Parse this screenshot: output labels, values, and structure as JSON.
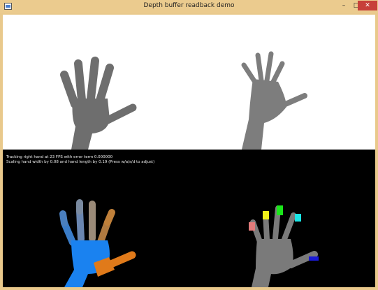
{
  "window": {
    "title": "Depth buffer readback demo",
    "controls": {
      "minimize": "–",
      "maximize": "□",
      "close": "✕"
    }
  },
  "status": {
    "line1": "Tracking right hand at 23 FPS with error term 0.000000",
    "line2": "Scaling hand width by 0.08 and hand length by 0.19 (Press w/a/s/d to adjust)"
  },
  "colors": {
    "titlebar": "#ebcb8e",
    "close": "#c7403a",
    "render_hand": "#6e6e6e",
    "depth_hand": "#7a7a7a",
    "palm_blue": "#1a82f0",
    "thumb_orange": "#e07a1a",
    "finger_index": "#e07a7a",
    "finger_middle": "#f2f21a",
    "finger_ring": "#1ae61a",
    "finger_pinky": "#1ae6e6",
    "thumb_tip": "#1a1ad6"
  },
  "panels": {
    "render": "rendered-hand-model",
    "depth": "depth-camera-hand",
    "parts": "segmented-hand-model",
    "tips": "fingertip-labels"
  }
}
